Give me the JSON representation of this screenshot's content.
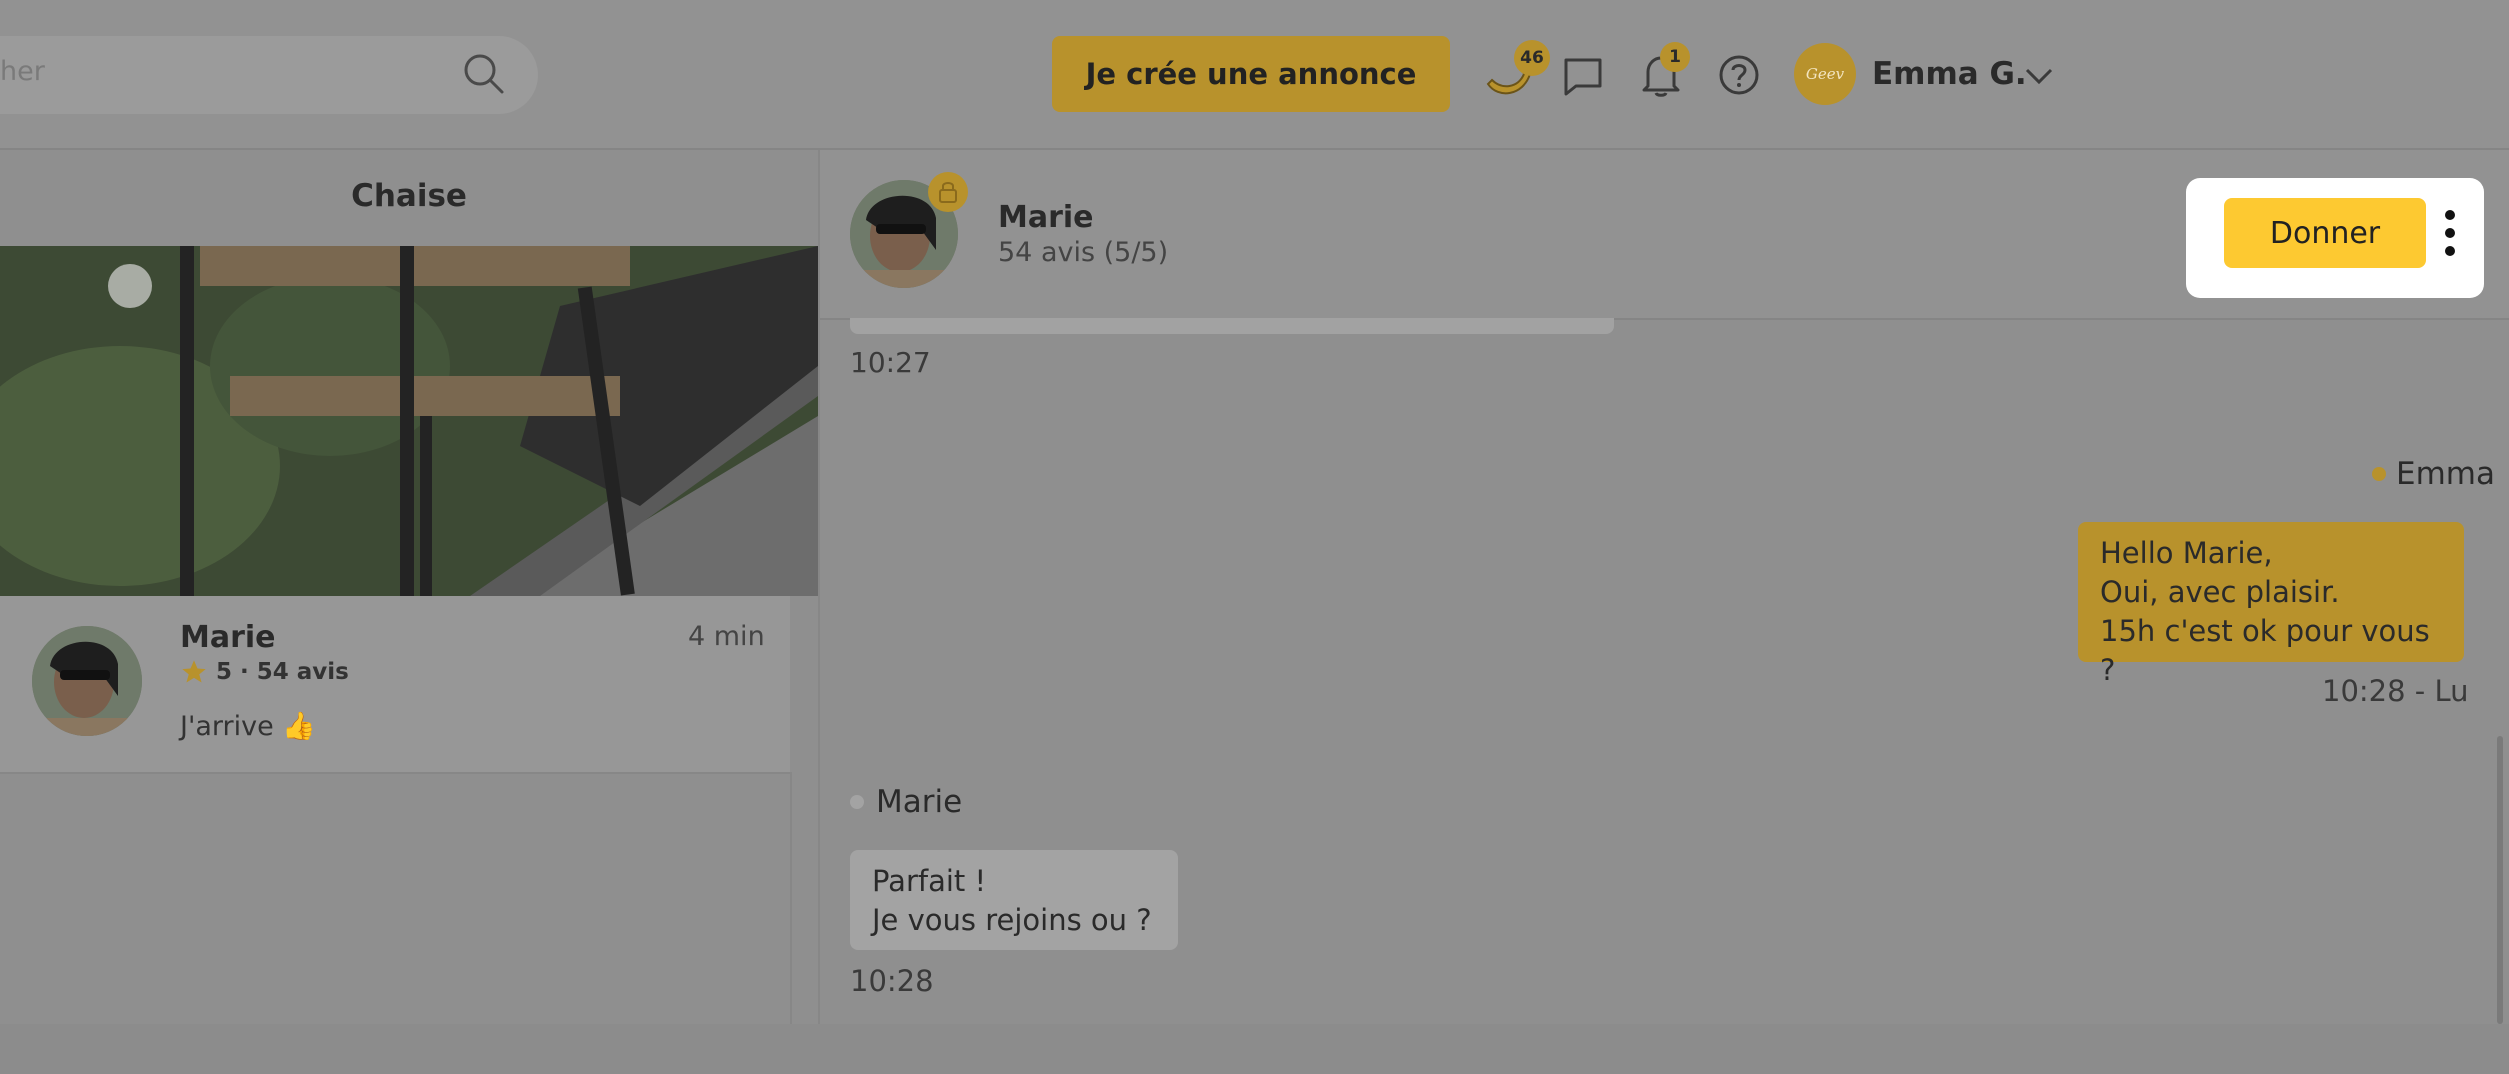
{
  "topbar": {
    "search_placeholder": "her",
    "create_button": "Je crée une annonce",
    "bananas_count": "46",
    "notifications_count": "1",
    "avatar_logo": "Geev",
    "user_name": "Emma G."
  },
  "listing": {
    "title": "Chaise"
  },
  "conversation": {
    "name": "Marie",
    "time": "4 min",
    "rating": "5 · 54 avis",
    "last_message": "J'arrive 👍"
  },
  "chat": {
    "contact_name": "Marie",
    "contact_reviews": "54 avis (5/5)",
    "give_button": "Donner",
    "messages": [
      {
        "time": "10:27"
      },
      {
        "sender": "Emma",
        "lines": [
          "Hello Marie,",
          "Oui, avec plaisir.",
          "15h c'est ok pour vous ?"
        ],
        "time": "10:28 - Lu"
      },
      {
        "sender": "Marie",
        "lines": [
          "Parfait !",
          "Je vous rejoins ou ?"
        ],
        "time": "10:28"
      }
    ]
  },
  "colors": {
    "accent": "#fdc931",
    "accent_dimmed": "#b8922c",
    "overlay_gray": "#8f8f8f"
  }
}
